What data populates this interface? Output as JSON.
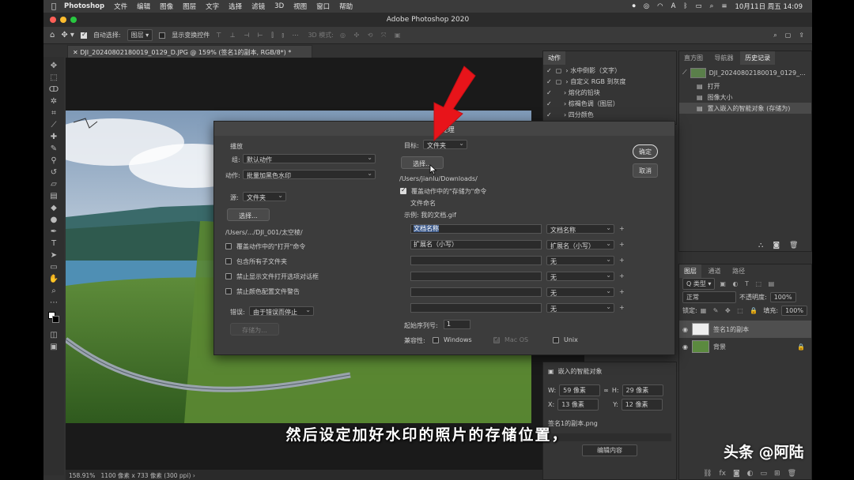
{
  "menubar": {
    "app": "Photoshop",
    "items": [
      "文件",
      "编辑",
      "图像",
      "图层",
      "文字",
      "选择",
      "滤镜",
      "3D",
      "视图",
      "窗口",
      "帮助"
    ],
    "datetime": "10月11日 周五 14:09"
  },
  "window": {
    "title": "Adobe Photoshop 2020"
  },
  "options": {
    "auto_select": "自动选择:",
    "layer_value": "图层",
    "transform": "显示变换控件",
    "mode3d": "3D 模式:"
  },
  "doc": {
    "tab": "DJI_20240802180019_0129_D.JPG @ 159% (签名1的副本, RGB/8*) *",
    "zoom": "158.91%",
    "size": "1100 像素 x 733 像素 (300 ppi)"
  },
  "actions": {
    "tab": "动作",
    "items": [
      "水中倒影（文字）",
      "自定义 RGB 到灰度",
      "熔化的铅块",
      "棕褐色调（图层）",
      "四分颜色"
    ]
  },
  "history": {
    "tabs": [
      "直方图",
      "导航器",
      "历史记录"
    ],
    "snapshot": "DJI_20240802180019_0129_...",
    "items": [
      "打开",
      "图像大小",
      "置入嵌入的智能对象 (存储为)"
    ]
  },
  "layers": {
    "tabs": [
      "图层",
      "通道",
      "路径"
    ],
    "kind": "Q 类型",
    "blend": "正常",
    "opacity_label": "不透明度:",
    "opacity": "100%",
    "lock_label": "锁定:",
    "fill_label": "填充:",
    "fill": "100%",
    "items": [
      "签名1的副本",
      "背景"
    ]
  },
  "props": {
    "title": "嵌入的智能对象",
    "w_label": "W:",
    "w": "59 像素",
    "h_label": "H:",
    "h": "29 像素",
    "x_label": "X:",
    "x": "13 像素",
    "y_label": "Y:",
    "y": "12 像素",
    "file": "签名1的副本.png",
    "edit_btn": "编辑内容"
  },
  "dialog": {
    "title": "批处理",
    "ok": "确定",
    "cancel": "取消",
    "play": "播放",
    "group_label": "组:",
    "group_value": "默认动作",
    "action_label": "动作:",
    "action_value": "批量加黑色水印",
    "source_label": "源:",
    "source_value": "文件夹",
    "choose": "选择...",
    "source_path": "/Users/.../DJI_001/太空棱/",
    "src_checks": [
      "覆盖动作中的\"打开\"命令",
      "包含所有子文件夹",
      "禁止显示文件打开选项对话框",
      "禁止颜色配置文件警告"
    ],
    "error_label": "错误:",
    "error_value": "由于错误而停止",
    "save_as": "存储为...",
    "dest_label": "目标:",
    "dest_value": "文件夹",
    "dest_choose": "选择...",
    "dest_path": "/Users/jianlu/Downloads/",
    "override_save": "覆盖动作中的\"存储为\"命令",
    "naming": "文件命名",
    "example": "示例: 我的文档.gif",
    "name_rows": [
      {
        "field": "文档名称",
        "sel": "文档名称"
      },
      {
        "field": "扩展名（小写）",
        "sel": "扩展名（小写）"
      },
      {
        "field": "",
        "sel": "无"
      },
      {
        "field": "",
        "sel": "无"
      },
      {
        "field": "",
        "sel": "无"
      },
      {
        "field": "",
        "sel": "无"
      }
    ],
    "serial_label": "起始序列号:",
    "serial": "1",
    "compat_label": "兼容性:",
    "compat": [
      "Windows",
      "Mac OS",
      "Unix"
    ]
  },
  "caption": "然后设定加好水印的照片的存储位置，",
  "watermark": "头条 @阿陆",
  "colors": {
    "accent_arrow": "#e8141a",
    "highlight": "#3d5a8a"
  }
}
